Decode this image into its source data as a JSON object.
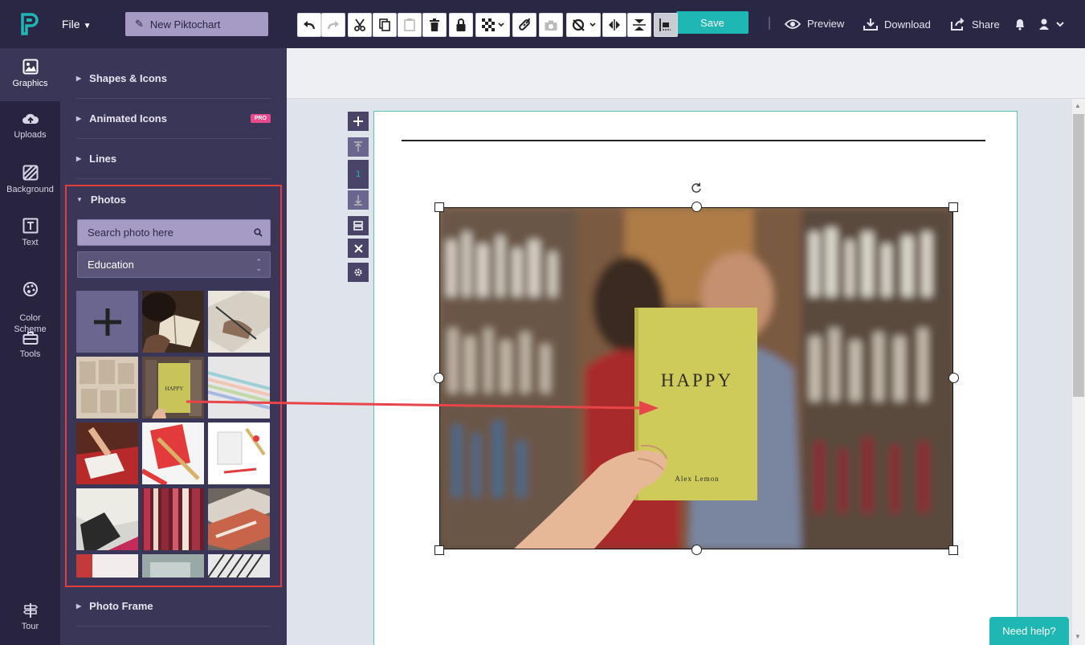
{
  "topbar": {
    "file_label": "File",
    "title": "New Piktochart",
    "save_label": "Save",
    "actions": [
      {
        "label": "Preview",
        "icon": "eye-icon"
      },
      {
        "label": "Download",
        "icon": "download-icon"
      },
      {
        "label": "Share",
        "icon": "share-icon"
      }
    ]
  },
  "rail": {
    "items": [
      {
        "label": "Graphics",
        "icon": "image-icon",
        "active": true
      },
      {
        "label": "Uploads",
        "icon": "cloud-upload-icon"
      },
      {
        "label": "Background",
        "icon": "background-icon"
      },
      {
        "label": "Text",
        "icon": "text-icon"
      },
      {
        "label": "Color\nScheme",
        "icon": "palette-icon"
      },
      {
        "label": "Tools",
        "icon": "toolbox-icon"
      }
    ],
    "tour_label": "Tour"
  },
  "panel": {
    "sections": [
      {
        "label": "Shapes & Icons"
      },
      {
        "label": "Animated Icons",
        "badge": "PRO"
      },
      {
        "label": "Lines"
      }
    ],
    "photos": {
      "label": "Photos",
      "search_placeholder": "Search photo here",
      "category": "Education",
      "thumb_book_text": "HAPPY"
    },
    "photo_frame_label": "Photo Frame"
  },
  "page_tools": {
    "page_number": "1"
  },
  "canvas": {
    "book_title": "HAPPY",
    "book_author": "Alex Lemon"
  },
  "help_label": "Need help?",
  "colors": {
    "topbar": "#2a2744",
    "panel": "#3a3658",
    "accent": "#1eb7b4",
    "highlight": "#e53c3c",
    "pro": "#e84a8c"
  }
}
